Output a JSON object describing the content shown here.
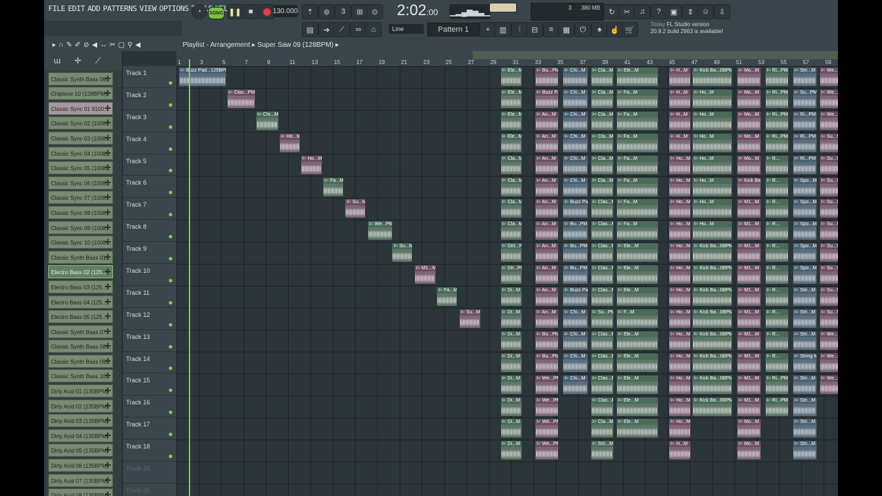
{
  "menu": [
    "FILE",
    "EDIT",
    "ADD",
    "PATTERNS",
    "VIEW",
    "OPTIONS",
    "TOOLS",
    "HELP"
  ],
  "transport": {
    "song_label": "SONG",
    "tempo": "130.000",
    "time": "2:02",
    "time_sub": ":00",
    "cpu": "3",
    "ram": "380 MB",
    "ram_sub": "1"
  },
  "pattern": {
    "label": "Pattern 1",
    "snap": "Line"
  },
  "news": {
    "day": "Today",
    "line1": "FL Studio version",
    "line2": "20.9.2 build 2963 is available!"
  },
  "playlist": {
    "title": "Playlist - Arrangement",
    "path": "Super Saw 09 (128BPM)"
  },
  "browser": {
    "items": [
      {
        "label": "Classic Synth Bass 06...",
        "style": "green"
      },
      {
        "label": "Chiptone 10 (128BPM)",
        "style": "green"
      },
      {
        "label": "Classic Sync 01 9100...",
        "style": "pink"
      },
      {
        "label": "Classic Sync 02 (1008...",
        "style": "green"
      },
      {
        "label": "Classic Sync 03 (1008...",
        "style": "green"
      },
      {
        "label": "Classic Sync 04 (1008...",
        "style": "green"
      },
      {
        "label": "Classic Sync 05 (1008...",
        "style": "green"
      },
      {
        "label": "Classic Sync 06 (1008...",
        "style": "green"
      },
      {
        "label": "Classic Sync 07 (1008...",
        "style": "green"
      },
      {
        "label": "Classic Sync 08 (1008...",
        "style": "green"
      },
      {
        "label": "Classic Sync 09 (1008...",
        "style": "green"
      },
      {
        "label": "Classic Sync 10 (1008...",
        "style": "green"
      },
      {
        "label": "Classic Synth Bass 01...",
        "style": "green"
      },
      {
        "label": "Electro Bass 02 (125...",
        "style": "sel"
      },
      {
        "label": "Electro Bass 03 (125...",
        "style": "green"
      },
      {
        "label": "Electro Bass 04 (125...",
        "style": "green"
      },
      {
        "label": "Electro Bass 05 (125...",
        "style": "green"
      },
      {
        "label": "Classic Synth Bass 07...",
        "style": "green"
      },
      {
        "label": "Classic Synth Bass 08...",
        "style": "green"
      },
      {
        "label": "Classic Synth Bass 09...",
        "style": "green"
      },
      {
        "label": "Classic Synth Bass 10...",
        "style": "green"
      },
      {
        "label": "Dirty Acid 01 (135BPM)",
        "style": "green"
      },
      {
        "label": "Dirty Acid 02 (135BPM)",
        "style": "green"
      },
      {
        "label": "Dirty Acid 03 (135BPM)",
        "style": "green"
      },
      {
        "label": "Dirty Acid 04 (135BPM)",
        "style": "green"
      },
      {
        "label": "Dirty Acid 05 (135BPM)",
        "style": "green"
      },
      {
        "label": "Dirty Acid 06 (135BPM)",
        "style": "green"
      },
      {
        "label": "Dirty Acid 07 (135BPM)",
        "style": "green"
      },
      {
        "label": "Dirty Acid 08 (135BPM)",
        "style": "green"
      }
    ]
  },
  "tracks": [
    "Track 1",
    "Track 2",
    "Track 3",
    "Track 4",
    "Track 5",
    "Track 6",
    "Track 7",
    "Track 8",
    "Track 9",
    "Track 10",
    "Track 11",
    "Track 12",
    "Track 13",
    "Track 14",
    "Track 15",
    "Track 16",
    "Track 17",
    "Track 18",
    "Track 19",
    "Track 20"
  ],
  "ruler": [
    "1",
    "3",
    "5",
    "7",
    "9",
    "11",
    "13",
    "15",
    "17",
    "19",
    "21",
    "23",
    "25",
    "27",
    "29",
    "31",
    "33",
    "35",
    "37",
    "39",
    "41",
    "43",
    "45",
    "47",
    "49",
    "51",
    "53",
    "55",
    "57",
    "59"
  ],
  "clips": {
    "intro": [
      {
        "label": "Buzz Pad...125BPM",
        "track": 0,
        "start": 1,
        "len": 4.3,
        "c": "blue"
      },
      {
        "label": "Clas...PM",
        "track": 1,
        "start": 5.3,
        "len": 2.6,
        "c": "pink"
      },
      {
        "label": "Chi...M",
        "track": 2,
        "start": 7.9,
        "len": 2.1,
        "c": "green"
      },
      {
        "label": "Ho...M",
        "track": 3,
        "start": 10,
        "len": 1.9,
        "c": "pink"
      },
      {
        "label": "Ho...M",
        "track": 4,
        "start": 11.9,
        "len": 2,
        "c": "pink"
      },
      {
        "label": "Fa...M",
        "track": 5,
        "start": 13.9,
        "len": 1.9,
        "c": "green"
      },
      {
        "label": "Su...M",
        "track": 6,
        "start": 15.9,
        "len": 1.9,
        "c": "pink"
      },
      {
        "label": "We...PM",
        "track": 7,
        "start": 17.9,
        "len": 2.3,
        "c": "green"
      },
      {
        "label": "Su...M",
        "track": 8,
        "start": 20.1,
        "len": 1.9,
        "c": "green"
      },
      {
        "label": "M1...M",
        "track": 9,
        "start": 22.1,
        "len": 2,
        "c": "pink"
      },
      {
        "label": "Fa...M",
        "track": 10,
        "start": 24.1,
        "len": 1.9,
        "c": "green"
      },
      {
        "label": "Su...M",
        "track": 11,
        "start": 26.1,
        "len": 2,
        "c": "pink"
      }
    ],
    "columns": [
      {
        "start": 29.8,
        "len": 2,
        "labels": [
          "Ele...M",
          "Ele...M",
          "Ele...M",
          "Ele...M",
          "Cla...M",
          "Cla...M",
          "Cla...M",
          "Cla...M",
          "Dirt...PM",
          "Dir...PM",
          "Di...M",
          "Di...M",
          "Di...M",
          "Di...M",
          "Di...M",
          "Di...M",
          "Di...M",
          "Di...M"
        ],
        "c": "green"
      },
      {
        "start": 32.9,
        "len": 2.2,
        "labels": [
          "Bu...PM",
          "Buzz Pad...",
          "An...M",
          "An...M",
          "An...M",
          "An...M",
          "An...M",
          "An...M",
          "An...M",
          "An...M",
          "An...M",
          "An...M",
          "Bu...PM",
          "Bu...PM",
          "We...PM",
          "We...PM",
          "We...PM",
          "We...PM"
        ],
        "c": "pink"
      },
      {
        "start": 35.4,
        "len": 2.3,
        "labels": [
          "Chi...M",
          "Chi...M",
          "Chi...M",
          "Chi...M",
          "Chi...M",
          "Chi...M",
          "Buzz Pad...",
          "Bu...PM",
          "Bu...PM",
          "Bu...PM",
          "Buzz Pad...",
          "Chi...M",
          "Chi...M",
          "Chi...M",
          "Chi...M",
          "",
          "",
          ""
        ],
        "c": "blue"
      },
      {
        "start": 37.9,
        "len": 2.1,
        "labels": [
          "Cla...M",
          "Cla...M",
          "Cla...M",
          "Cla...M",
          "Cla...M",
          "Cla...M",
          "Clas...PM",
          "Clas...PM",
          "Clas...PM",
          "Clas...PM",
          "Clas...PM",
          "Su...PM",
          "Clas...PM",
          "Clas...PM",
          "Clas...PM",
          "Clas...PM",
          "Cla...M",
          "Stri...M"
        ],
        "c": "green"
      },
      {
        "start": 40.2,
        "len": 3.8,
        "labels": [
          "Ele...M",
          "Fa...M",
          "Fa...M",
          "Fa...M",
          "Fa...M",
          "Fa...M",
          "Fa...M",
          "Fa...M",
          "Ele...M",
          "Ele...M",
          "Ele...M",
          "F...M",
          "Ele...M",
          "Ele...M",
          "Ele...M",
          "Ele...M",
          "Ele...M",
          ""
        ],
        "c": "green"
      },
      {
        "start": 44.9,
        "len": 2,
        "labels": [
          "H...M",
          "H...M",
          "H...M",
          "H...M",
          "Ho...M",
          "Ho...M",
          "Ho...M",
          "Ho...M",
          "Ho...M",
          "Ho...M",
          "Ho...M",
          "Ho...M",
          "Ho...M",
          "Ho...M",
          "Ho...M",
          "Ho...M",
          "Ho...M",
          "H...M"
        ],
        "c": "pink"
      },
      {
        "start": 47,
        "len": 3.6,
        "labels": [
          "Kick Ba...0BPM",
          "Ho...M",
          "Ho...M",
          "Ho...M",
          "Ho...M",
          "Ho...M",
          "Ho...M",
          "Ho...M",
          "Kick Ba...0BPM",
          "Kick Ba...0BPM",
          "Kick Ba...0BPM",
          "Kick Ba...0BPM",
          "Kick Ba...0BPM",
          "Kick Ba...0BPM",
          "Kick Ba...0BPM",
          "Kick Ba...0BPM",
          "",
          ""
        ],
        "c": "green"
      },
      {
        "start": 51,
        "len": 2.2,
        "labels": [
          "Mo...M",
          "Mo...M",
          "Mo...M",
          "Mo...M",
          "Mo...M",
          "Kick Ba...",
          "M1...M",
          "M1...M",
          "M1...M",
          "M1...M",
          "M1...M",
          "M1...M",
          "M1...M",
          "M1...M",
          "M1...M",
          "M1...M",
          "Mo...M",
          "Mo...M"
        ],
        "c": "pink"
      },
      {
        "start": 53.5,
        "len": 2.2,
        "labels": [
          "Ri...PM",
          "Ri...PM",
          "Ri...PM",
          "Ri...PM",
          "R...",
          "R...",
          "R...",
          "R...",
          "R...",
          "R...",
          "R...",
          "R...",
          "R...",
          "R...",
          "Ri...PM",
          "Ri...PM",
          "",
          ""
        ],
        "c": "green"
      },
      {
        "start": 56,
        "len": 2.2,
        "labels": [
          "Stri...M",
          "Su...PM",
          "Ri...PM",
          "Ri...PM",
          "Ri...PM",
          "Spo...M",
          "Spo...M",
          "Spo...M",
          "Spo...M",
          "Spo...M",
          "Stri...M",
          "Stri...M",
          "Stri...M",
          "String M...",
          "Stri...M",
          "Stri...M",
          "Stri...M",
          "Stri...M"
        ],
        "c": "blue"
      },
      {
        "start": 58.4,
        "len": 2.2,
        "labels": [
          "We...PM",
          "We...PM",
          "We...PM",
          "Su...M",
          "Su...M",
          "Su...M",
          "Su...M",
          "Su...M",
          "Su...M",
          "Su...M",
          "Su...M",
          "Su...M",
          "We...PM",
          "We...PM",
          "We...PM",
          "",
          "",
          ""
        ],
        "c": "pink"
      }
    ]
  }
}
